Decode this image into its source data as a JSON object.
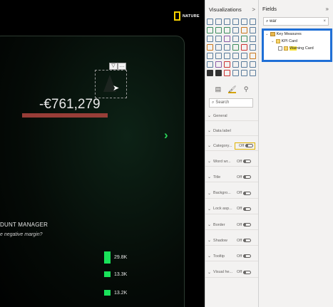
{
  "report": {
    "logo_text": "NATURE",
    "kpi_value": "-€761,279",
    "next_arrow": "›",
    "account_title": "DUNT MANAGER",
    "account_subtitle": "e negative margin?",
    "bars": [
      {
        "label": "29.8K",
        "value": 29.8
      },
      {
        "label": "13.3K",
        "value": 13.3
      },
      {
        "label": "13.2K",
        "value": 13.2
      }
    ]
  },
  "visualizations": {
    "title": "Visualizations",
    "collapse": ">",
    "search_placeholder": "Search",
    "format_rows": [
      {
        "name": "General",
        "has_toggle": false
      },
      {
        "name": "Data label",
        "has_toggle": false
      },
      {
        "name": "Category...",
        "has_toggle": true,
        "toggle_text": "Off",
        "highlighted": true
      },
      {
        "name": "Word wr...",
        "has_toggle": true,
        "toggle_text": "Off"
      },
      {
        "name": "Title",
        "has_toggle": true,
        "toggle_text": "Off"
      },
      {
        "name": "Backgro...",
        "has_toggle": true,
        "toggle_text": "Off"
      },
      {
        "name": "Lock asp...",
        "has_toggle": true,
        "toggle_text": "Off"
      },
      {
        "name": "Border",
        "has_toggle": true,
        "toggle_text": "Off"
      },
      {
        "name": "Shadow",
        "has_toggle": true,
        "toggle_text": "Off"
      },
      {
        "name": "Tooltip",
        "has_toggle": true,
        "toggle_text": "Off"
      },
      {
        "name": "Visual he...",
        "has_toggle": true,
        "toggle_text": "Off"
      }
    ]
  },
  "fields": {
    "title": "Fields",
    "expand": "»",
    "search_value": "war",
    "clear": "×",
    "tree": {
      "root": "Key Measures",
      "folder": "KPI Card",
      "measure_highlight": "War",
      "measure_rest": "ning Card"
    }
  },
  "colors": {
    "accent_blue": "#1f6fd6",
    "kpi_bar": "#b1453f",
    "bar_green": "#19e25a",
    "highlight_yellow": "#f7e33b"
  }
}
